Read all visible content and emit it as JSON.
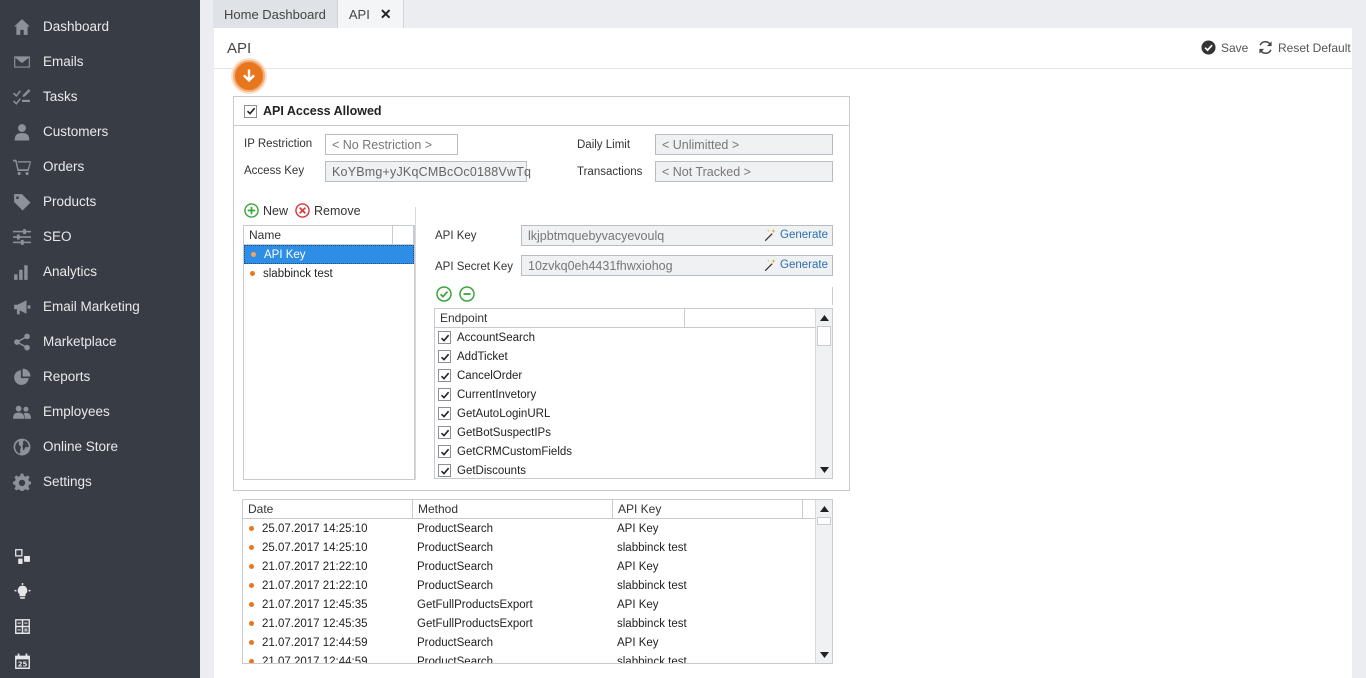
{
  "sidebar": {
    "items": [
      {
        "label": "Dashboard",
        "icon": "home-icon"
      },
      {
        "label": "Emails",
        "icon": "envelope-icon"
      },
      {
        "label": "Tasks",
        "icon": "tasks-icon"
      },
      {
        "label": "Customers",
        "icon": "user-icon"
      },
      {
        "label": "Orders",
        "icon": "cart-icon"
      },
      {
        "label": "Products",
        "icon": "tag-icon"
      },
      {
        "label": "SEO",
        "icon": "sliders-icon"
      },
      {
        "label": "Analytics",
        "icon": "bar-chart-icon"
      },
      {
        "label": "Email Marketing",
        "icon": "megaphone-icon"
      },
      {
        "label": "Marketplace",
        "icon": "share-icon"
      },
      {
        "label": "Reports",
        "icon": "pie-chart-icon"
      },
      {
        "label": "Employees",
        "icon": "users-icon"
      },
      {
        "label": "Online Store",
        "icon": "globe-icon"
      },
      {
        "label": "Settings",
        "icon": "gear-icon"
      }
    ],
    "bottom_icons": [
      "windows-icon",
      "lightbulb-icon",
      "calculator-icon",
      "calendar-icon"
    ]
  },
  "tabs": [
    {
      "label": "Home Dashboard"
    },
    {
      "label": "API",
      "close": "✕"
    }
  ],
  "header": {
    "title": "API",
    "save_label": "Save",
    "reset_label": "Reset Default"
  },
  "api": {
    "access_allowed_label": "API Access Allowed",
    "access_allowed": true,
    "ip_restriction_label": "IP Restriction",
    "ip_restriction_value": "< No Restriction >",
    "access_key_label": "Access Key",
    "access_key_value": "KoYBmg+yJKqCMBcOc0188VwTq",
    "daily_limit_label": "Daily Limit",
    "daily_limit_value": "< Unlimitted >",
    "transactions_label": "Transactions",
    "transactions_value": "< Not Tracked >",
    "new_label": "New",
    "remove_label": "Remove",
    "keys_header": "Name",
    "keys": [
      {
        "name": "API Key",
        "selected": true
      },
      {
        "name": "slabbinck test",
        "selected": false
      }
    ],
    "api_key_label": "API Key",
    "api_key_value": "lkjpbtmquebyvacyevoulq",
    "api_secret_label": "API Secret Key",
    "api_secret_value": "10zvkq0eh4431fhwxiohog",
    "generate_label": "Generate",
    "endpoint_header": "Endpoint",
    "endpoints": [
      "AccountSearch",
      "AddTicket",
      "CancelOrder",
      "CurrentInvetory",
      "GetAutoLoginURL",
      "GetBotSuspectIPs",
      "GetCRMCustomFields",
      "GetDiscounts"
    ]
  },
  "log": {
    "headers": [
      "Date",
      "Method",
      "API Key"
    ],
    "rows": [
      {
        "date": "25.07.2017 14:25:10",
        "method": "ProductSearch",
        "key": "API Key"
      },
      {
        "date": "25.07.2017 14:25:10",
        "method": "ProductSearch",
        "key": "slabbinck test"
      },
      {
        "date": "21.07.2017 21:22:10",
        "method": "ProductSearch",
        "key": "API Key"
      },
      {
        "date": "21.07.2017 21:22:10",
        "method": "ProductSearch",
        "key": "slabbinck test"
      },
      {
        "date": "21.07.2017 12:45:35",
        "method": "GetFullProductsExport",
        "key": "API Key"
      },
      {
        "date": "21.07.2017 12:45:35",
        "method": "GetFullProductsExport",
        "key": "slabbinck test"
      },
      {
        "date": "21.07.2017 12:44:59",
        "method": "ProductSearch",
        "key": "API Key"
      },
      {
        "date": "21.07.2017 12:44:59",
        "method": "ProductSearch",
        "key": "slabbinck test"
      }
    ]
  },
  "colors": {
    "sidebar_bg": "#383c44",
    "accent_orange": "#e8761f",
    "selection_blue": "#2e8ee6",
    "link_blue": "#2d6fb0",
    "add_green": "#3aa53a",
    "remove_red": "#d9343a"
  }
}
